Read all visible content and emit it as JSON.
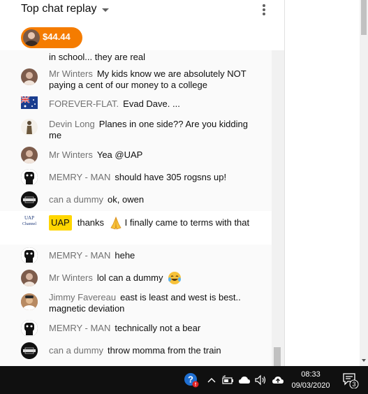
{
  "header": {
    "title": "Top chat replay",
    "menu_icon": "more-vert-icon"
  },
  "donation": {
    "amount": "$44.44",
    "color": "#f57c00"
  },
  "messages": [
    {
      "author": "",
      "text": "in school... they are real",
      "avatar": "none"
    },
    {
      "author": "Mr Winters",
      "text": "My kids know we are absolutely NOT paying a cent of our money to a college",
      "avatar": "avatar-person-icon"
    },
    {
      "author": "FOREVER-FLAT.",
      "text": "Evad Dave. ...",
      "avatar": "australia-flag-icon"
    },
    {
      "author": "Devin Long",
      "text": "Planes in one side?? Are you kidding me",
      "avatar": "statue-avatar-icon"
    },
    {
      "author": "Mr Winters",
      "text": "Yea @UAP",
      "avatar": "avatar-person-icon"
    },
    {
      "author": "MEMRY - MAN",
      "text": "should have 305 rogsns up!",
      "avatar": "robot-avatar-icon"
    },
    {
      "author": "can a dummy",
      "text": "ok, owen",
      "avatar": "dummy-avatar-icon"
    },
    {
      "author": "UAP",
      "text_before": "thanks",
      "emoji": "folded-hands-emoji-icon",
      "text_after": "I finally came to terms with that",
      "avatar": "uap-channel-logo",
      "avatar_text": [
        "UAP",
        "Channel"
      ]
    },
    {
      "author": "MEMRY - MAN",
      "text": "hehe",
      "avatar": "robot-avatar-icon"
    },
    {
      "author": "Mr Winters",
      "text": "lol can a dummy",
      "emoji": "laughing-tears-emoji-icon",
      "avatar": "avatar-person-icon"
    },
    {
      "author": "Jimmy Favereau",
      "text": "east is least and west is best.. magnetic deviation",
      "avatar": "photo-avatar-icon"
    },
    {
      "author": "MEMRY - MAN",
      "text": "technically not a bear",
      "avatar": "robot-avatar-icon"
    },
    {
      "author": "can a dummy",
      "text": "throw momma from the train",
      "avatar": "dummy-avatar-icon"
    }
  ],
  "taskbar": {
    "time": "08:33",
    "date": "09/03/2020",
    "notification_count": "3",
    "tray_icons": [
      "help-icon",
      "chevron-up-icon",
      "battery-icon",
      "cloud-icon",
      "speaker-icon",
      "upload-icon",
      "notification-center-icon"
    ]
  }
}
